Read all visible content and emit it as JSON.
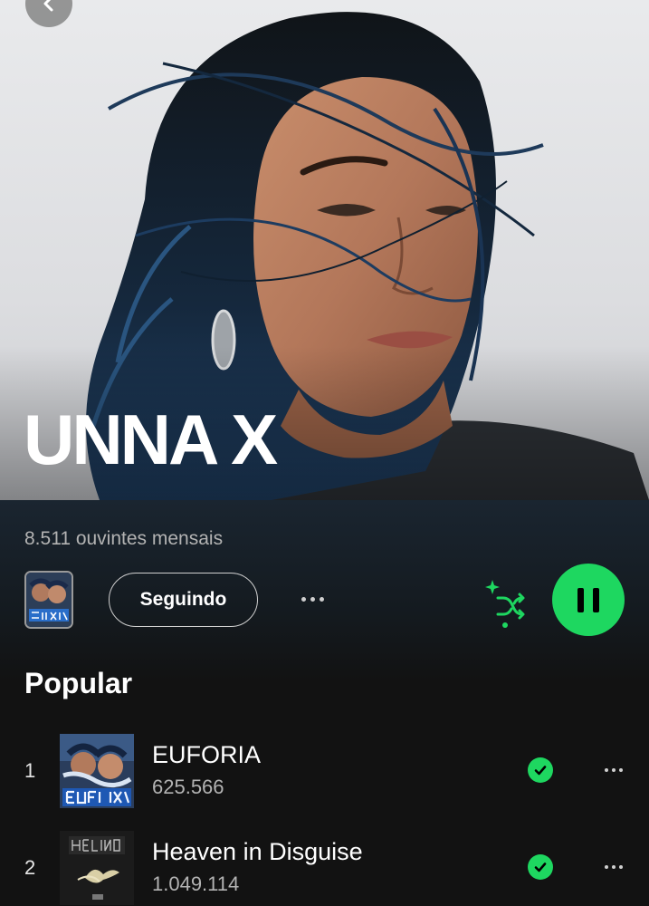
{
  "artist": {
    "name": "UNNA X",
    "monthly_listeners": "8.511 ouvintes mensais"
  },
  "actions": {
    "follow_label": "Seguindo",
    "is_playing": true
  },
  "popular": {
    "title": "Popular",
    "tracks": [
      {
        "rank": "1",
        "title": "EUFORIA",
        "plays": "625.566",
        "saved": true
      },
      {
        "rank": "2",
        "title": "Heaven in Disguise",
        "plays": "1.049.114",
        "saved": true
      }
    ]
  },
  "icons": {
    "back": "chevron-left-icon",
    "more": "more-horizontal-icon",
    "shuffle": "smart-shuffle-icon",
    "pause": "pause-icon",
    "saved": "check-circle-icon"
  },
  "colors": {
    "accent": "#1ed760",
    "background": "#121212",
    "secondary_text": "#b3b3b3"
  }
}
